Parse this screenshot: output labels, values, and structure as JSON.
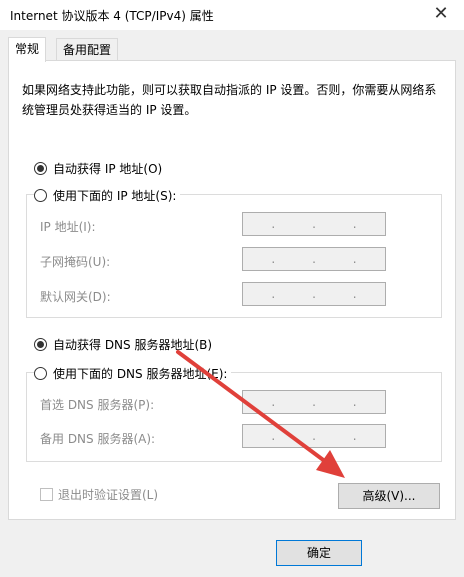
{
  "window": {
    "title": "Internet 协议版本 4 (TCP/IPv4) 属性",
    "close_glyph": "✕"
  },
  "tabs": [
    {
      "label": "常规"
    },
    {
      "label": "备用配置"
    }
  ],
  "description": "如果网络支持此功能，则可以获取自动指派的 IP 设置。否则，你需要从网络系统管理员处获得适当的 IP 设置。",
  "ip": {
    "auto_label": "自动获得 IP 地址(O)",
    "manual_label": "使用下面的 IP 地址(S):",
    "auto_selected": true,
    "fields": [
      {
        "label": "IP 地址(I):"
      },
      {
        "label": "子网掩码(U):"
      },
      {
        "label": "默认网关(D):"
      }
    ]
  },
  "dns": {
    "auto_label": "自动获得 DNS 服务器地址(B)",
    "manual_label": "使用下面的 DNS 服务器地址(E):",
    "auto_selected": true,
    "fields": [
      {
        "label": "首选 DNS 服务器(P):"
      },
      {
        "label": "备用 DNS 服务器(A):"
      }
    ]
  },
  "ip_dot": ".",
  "validate_label": "退出时验证设置(L)",
  "advanced_button": "高级(V)...",
  "ok_button": "确定",
  "colors": {
    "arrow": "#e0403a"
  }
}
